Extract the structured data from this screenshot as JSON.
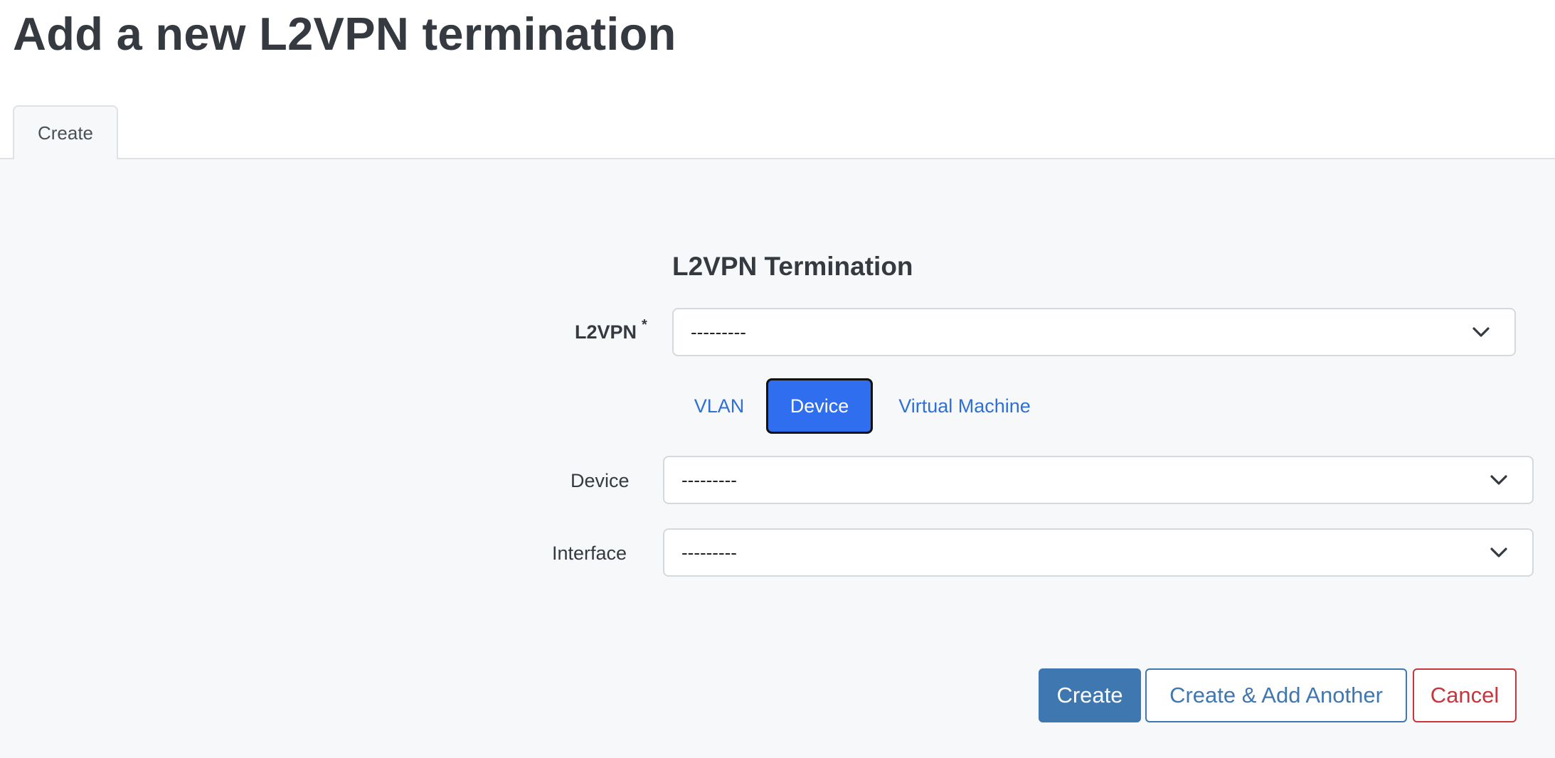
{
  "page": {
    "title": "Add a new L2VPN termination"
  },
  "tabs": [
    {
      "label": "Create"
    }
  ],
  "form": {
    "section_title": "L2VPN Termination",
    "l2vpn": {
      "label": "L2VPN",
      "required_marker": "*",
      "value": "---------"
    },
    "assignment_tabs": [
      {
        "label": "VLAN",
        "active": false
      },
      {
        "label": "Device",
        "active": true
      },
      {
        "label": "Virtual Machine",
        "active": false
      }
    ],
    "device": {
      "label": "Device",
      "value": "---------"
    },
    "interface": {
      "label": "Interface",
      "value": "---------"
    }
  },
  "actions": {
    "create_label": "Create",
    "create_add_another_label": "Create & Add Another",
    "cancel_label": "Cancel"
  },
  "colors": {
    "primary": "#3f77b1",
    "active_pill": "#2f6fef",
    "danger": "#c8353c",
    "link": "#2f6fd6"
  }
}
